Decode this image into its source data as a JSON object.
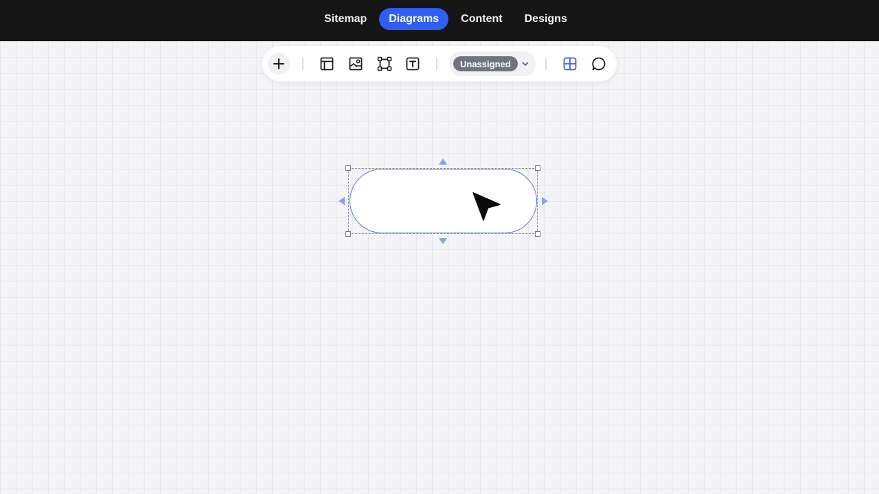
{
  "nav": {
    "tabs": [
      {
        "label": "Sitemap",
        "active": false
      },
      {
        "label": "Diagrams",
        "active": true
      },
      {
        "label": "Content",
        "active": false
      },
      {
        "label": "Designs",
        "active": false
      }
    ],
    "active_color": "#2f5ef5"
  },
  "toolbar": {
    "tools": [
      {
        "icon": "plus-icon"
      },
      {
        "icon": "layout-icon"
      },
      {
        "icon": "image-icon"
      },
      {
        "icon": "frame-icon"
      },
      {
        "icon": "text-icon"
      },
      {
        "icon": "grid-icon"
      },
      {
        "icon": "comment-icon"
      }
    ],
    "status_dropdown": {
      "selected": "Unassigned",
      "icon": "chevron-down-icon"
    }
  },
  "canvas": {
    "shape": {
      "type": "rounded-rectangle",
      "selected": true,
      "stroke_color": "#5b77d6",
      "connector_color": "#8ba2e3"
    }
  }
}
